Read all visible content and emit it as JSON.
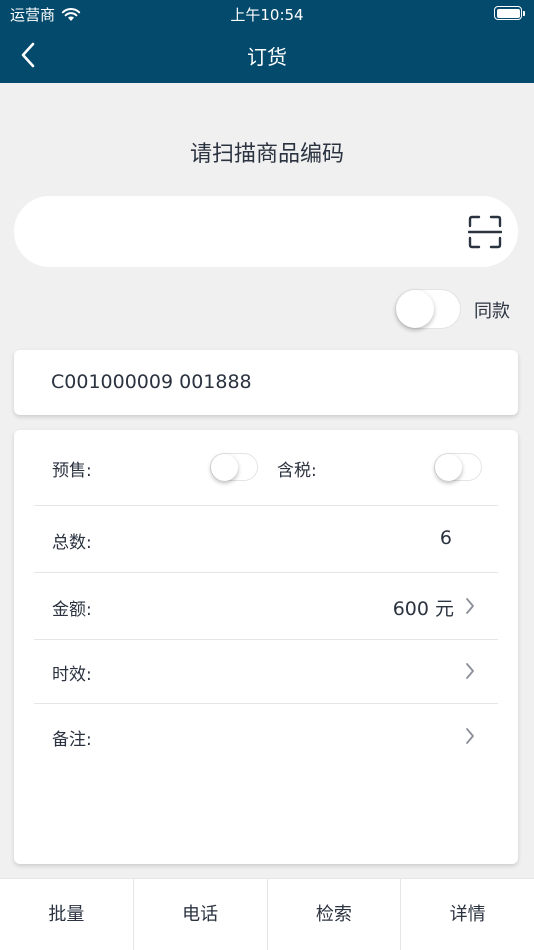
{
  "status_bar": {
    "carrier": "运营商",
    "time": "上午10:54"
  },
  "nav": {
    "title": "订货"
  },
  "scan": {
    "title": "请扫描商品编码",
    "input_value": "",
    "placeholder": ""
  },
  "same_style": {
    "label": "同款",
    "on": false
  },
  "product_code": "C001000009 001888",
  "details": {
    "presale_label": "预售:",
    "tax_label": "含税:",
    "total_label": "总数:",
    "total_value": "6",
    "amount_label": "金额:",
    "amount_value": "600 元",
    "timeliness_label": "时效:",
    "remark_label": "备注:"
  },
  "tabs": [
    "批量",
    "电话",
    "检索",
    "详情"
  ],
  "colors": {
    "header": "#034a6c",
    "background": "#f0f0f0",
    "text": "#2b3340"
  }
}
